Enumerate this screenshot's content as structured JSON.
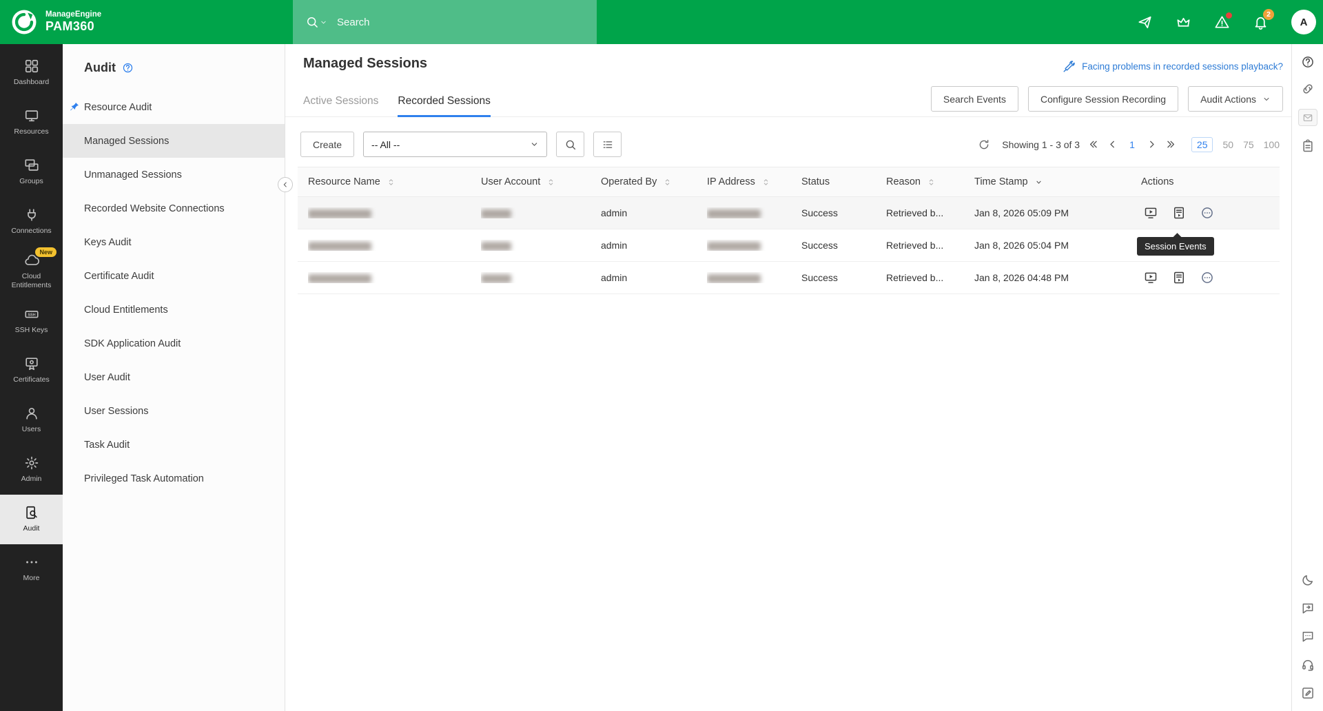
{
  "topbar": {
    "brand_line1": "ManageEngine",
    "brand_line2": "PAM360",
    "search_placeholder": "Search",
    "bell_badge": "2",
    "avatar_initial": "A"
  },
  "left_rail": {
    "items": [
      {
        "id": "dashboard",
        "icon": "dashboard",
        "label": "Dashboard"
      },
      {
        "id": "resources",
        "icon": "monitor",
        "label": "Resources"
      },
      {
        "id": "groups",
        "icon": "groups",
        "label": "Groups"
      },
      {
        "id": "connections",
        "icon": "plug",
        "label": "Connections"
      },
      {
        "id": "cloud-entitlements",
        "icon": "cloud",
        "label": "Cloud Entitlements",
        "badge": "New"
      },
      {
        "id": "ssh-keys",
        "icon": "ssh",
        "label": "SSH Keys"
      },
      {
        "id": "certificates",
        "icon": "certificate",
        "label": "Certificates"
      },
      {
        "id": "users",
        "icon": "user",
        "label": "Users"
      },
      {
        "id": "admin",
        "icon": "gear",
        "label": "Admin"
      },
      {
        "id": "audit",
        "icon": "audit",
        "label": "Audit",
        "active": true
      },
      {
        "id": "more",
        "icon": "ellipsis",
        "label": "More"
      }
    ]
  },
  "sidebar": {
    "title": "Audit",
    "items": [
      {
        "label": "Resource Audit",
        "pinned": true
      },
      {
        "label": "Managed Sessions",
        "active": true
      },
      {
        "label": "Unmanaged Sessions"
      },
      {
        "label": "Recorded Website Connections"
      },
      {
        "label": "Keys Audit"
      },
      {
        "label": "Certificate Audit"
      },
      {
        "label": "Cloud Entitlements"
      },
      {
        "label": "SDK Application Audit"
      },
      {
        "label": "User Audit"
      },
      {
        "label": "User Sessions"
      },
      {
        "label": "Task Audit"
      },
      {
        "label": "Privileged Task Automation"
      }
    ]
  },
  "main": {
    "title": "Managed Sessions",
    "playback_link": "Facing problems in recorded sessions playback?",
    "tabs": [
      {
        "label": "Active Sessions",
        "active": false
      },
      {
        "label": "Recorded Sessions",
        "active": true
      }
    ],
    "header_buttons": {
      "search_events": "Search Events",
      "configure_session_recording": "Configure Session Recording",
      "audit_actions": "Audit Actions"
    },
    "toolbar": {
      "create_label": "Create",
      "filter_value": "-- All --"
    },
    "status_bar": {
      "showing": "Showing 1 - 3 of 3",
      "current_page": "1",
      "page_sizes": [
        "25",
        "50",
        "75",
        "100"
      ],
      "active_page_size": "25"
    },
    "table": {
      "headers": [
        {
          "label": "Resource Name",
          "sort": "both"
        },
        {
          "label": "User Account",
          "sort": "both"
        },
        {
          "label": "Operated By",
          "sort": "both"
        },
        {
          "label": "IP Address",
          "sort": "both"
        },
        {
          "label": "Status",
          "sort": "none"
        },
        {
          "label": "Reason",
          "sort": "both"
        },
        {
          "label": "Time Stamp",
          "sort": "down"
        },
        {
          "label": "Actions",
          "sort": "none"
        }
      ],
      "rows": [
        {
          "resource_redacted": true,
          "account_redacted": true,
          "operated_by": "admin",
          "ip_redacted": true,
          "status": "Success",
          "reason": "Retrieved b...",
          "timestamp": "Jan 8, 2026 05:09 PM",
          "hovered": true
        },
        {
          "resource_redacted": true,
          "account_redacted": true,
          "operated_by": "admin",
          "ip_redacted": true,
          "status": "Success",
          "reason": "Retrieved b...",
          "timestamp": "Jan 8, 2026 05:04 PM",
          "hovered": false
        },
        {
          "resource_redacted": true,
          "account_redacted": true,
          "operated_by": "admin",
          "ip_redacted": true,
          "status": "Success",
          "reason": "Retrieved b...",
          "timestamp": "Jan 8, 2026 04:48 PM",
          "hovered": false
        }
      ]
    },
    "tooltip": "Session Events"
  },
  "colors": {
    "topbar_green": "#00a44a",
    "search_green": "#4fbd88",
    "accent_blue": "#2f80ed",
    "link_blue": "#2e7cd6",
    "badge_yellow": "#f3c12f",
    "alert_red": "#e8413c",
    "notification_orange": "#f0a13a"
  }
}
